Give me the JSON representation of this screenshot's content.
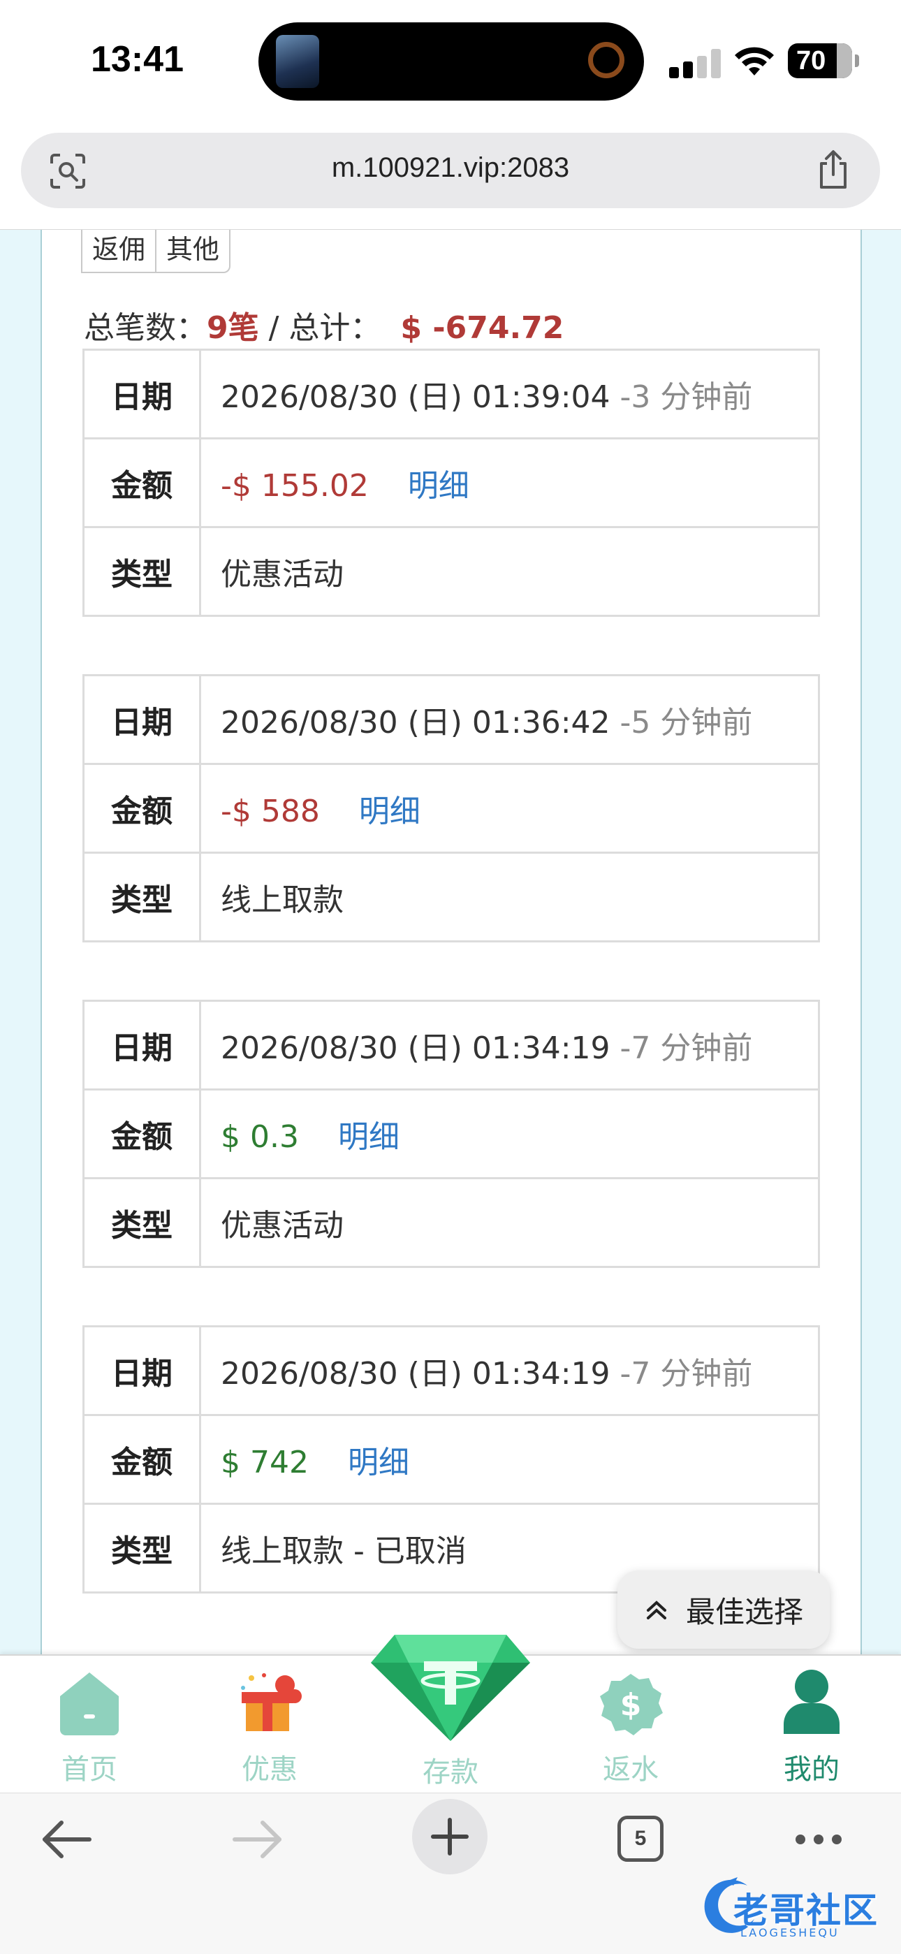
{
  "status_bar": {
    "time": "13:41",
    "battery": "70",
    "icons": [
      "signal-icon",
      "wifi-icon",
      "battery-icon"
    ]
  },
  "browser": {
    "url": "m.100921.vip:2083",
    "tab_count": "5",
    "icons": [
      "screenshot-search-icon",
      "share-icon",
      "back-arrow-icon",
      "forward-arrow-icon",
      "new-tab-icon",
      "tabs-icon",
      "more-icon"
    ]
  },
  "filters": {
    "tabs": [
      {
        "label": "返佣"
      },
      {
        "label": "其他"
      }
    ]
  },
  "summary": {
    "count_label": "总笔数：",
    "count_value": "9笔",
    "separator": " / ",
    "total_label": "总计：",
    "total_value": "$ -674.72"
  },
  "records": [
    {
      "date_label": "日期",
      "date": "2026/08/30 (日) 01:39:04 ",
      "ago": "-3 分钟前",
      "amount_label": "金额",
      "amount": "-$ 155.02",
      "amount_sign": "negative",
      "detail": "明细",
      "type_label": "类型",
      "type": "优惠活动"
    },
    {
      "date_label": "日期",
      "date": "2026/08/30 (日) 01:36:42 ",
      "ago": "-5 分钟前",
      "amount_label": "金额",
      "amount": "-$ 588",
      "amount_sign": "negative",
      "detail": "明细",
      "type_label": "类型",
      "type": "线上取款"
    },
    {
      "date_label": "日期",
      "date": "2026/08/30 (日) 01:34:19 ",
      "ago": "-7 分钟前",
      "amount_label": "金额",
      "amount": "$ 0.3",
      "amount_sign": "positive",
      "detail": "明细",
      "type_label": "类型",
      "type": "优惠活动"
    },
    {
      "date_label": "日期",
      "date": "2026/08/30 (日) 01:34:19 ",
      "ago": "-7 分钟前",
      "amount_label": "金额",
      "amount": "$ 742",
      "amount_sign": "positive",
      "detail": "明细",
      "type_label": "类型",
      "type": "线上取款 - 已取消"
    }
  ],
  "float_button": {
    "label": "最佳选择",
    "icon": "chevron-up-icon"
  },
  "tabbar": {
    "items": [
      {
        "label": "首页",
        "icon": "home-icon",
        "active": false
      },
      {
        "label": "优惠",
        "icon": "gift-icon",
        "active": false
      },
      {
        "label": "存款",
        "icon": "diamond-tether-icon",
        "active": false
      },
      {
        "label": "返水",
        "icon": "dollar-badge-icon",
        "active": false
      },
      {
        "label": "我的",
        "icon": "user-icon",
        "active": true
      }
    ]
  },
  "watermark": {
    "text": "老哥社区",
    "subtext": "LAOGESHEQU"
  },
  "colors": {
    "negative": "#b03a37",
    "positive": "#2e7d32",
    "link": "#2f78c4",
    "tab_inactive": "#9dd4c5",
    "tab_active": "#1f8a6d"
  }
}
